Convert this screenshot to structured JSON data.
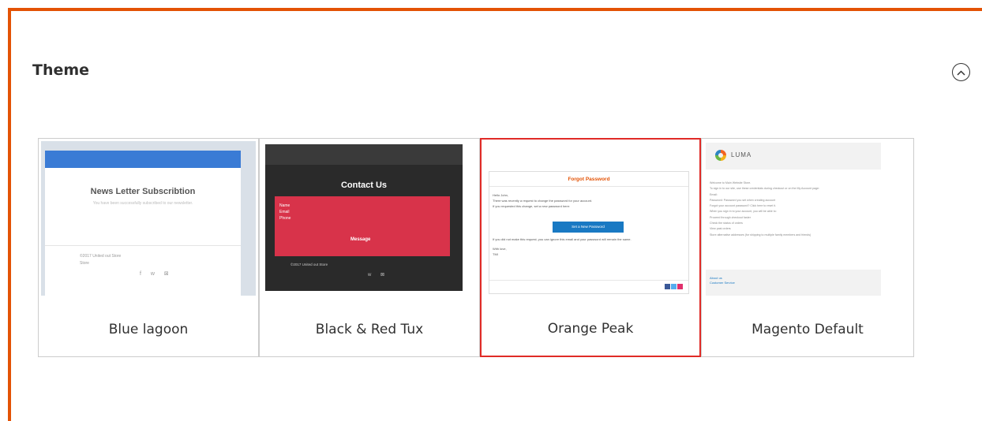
{
  "section": {
    "title": "Theme"
  },
  "themes": [
    {
      "label": "Blue lagoon",
      "selected": false,
      "preview": {
        "title": "News Letter Subscribtion",
        "subtitle": "You have been successfully subscribed to our newsletter.",
        "footer_line1": "©2017 United out Store",
        "footer_line2": "Store",
        "social": "f ᴡ ⊠"
      }
    },
    {
      "label": "Black & Red Tux",
      "selected": false,
      "preview": {
        "title": "Contact Us",
        "field_name": "Name",
        "field_email": "Email",
        "field_phone": "Phone",
        "message": "Message",
        "footer": "©2017 United out Store",
        "social": "ᴡ ⊠"
      }
    },
    {
      "label": "Orange Peak",
      "selected": true,
      "preview": {
        "title": "Forgot Password",
        "greeting": "Hello John,",
        "line1": "There was recently a request to change the password for your account.",
        "line2": "If you requested this change, set a new password here:",
        "button": "Set a New Password",
        "line3": "If you did not make this request, you can ignore this email and your password will remain the same.",
        "signoff1": "With love,",
        "signoff2": "TMI"
      }
    },
    {
      "label": "Magento Default",
      "selected": false,
      "preview": {
        "brand": "LUMA",
        "line1": "Welcome to Main Website Store.",
        "line2": "To sign in to our site, use these credentials during checkout or on the My Account page:",
        "line3": "Email:",
        "line4": "Password: Password you set when creating account",
        "line5": "Forgot your account password? Click here to reset it.",
        "line6": "When you sign in to your account, you will be able to:",
        "line7": "Proceed through checkout faster",
        "line8": "Check the status of orders",
        "line9": "View past orders",
        "line10": "Store alternative addresses (for shipping to multiple family members and friends)",
        "footer1": "About us",
        "footer2": "Customer Service"
      }
    }
  ],
  "colors": {
    "accent": "#e35205",
    "selected_border": "#e02b27",
    "card_border": "#cccccc"
  },
  "icons": {
    "collapse": "chevron-up-circle-icon"
  }
}
